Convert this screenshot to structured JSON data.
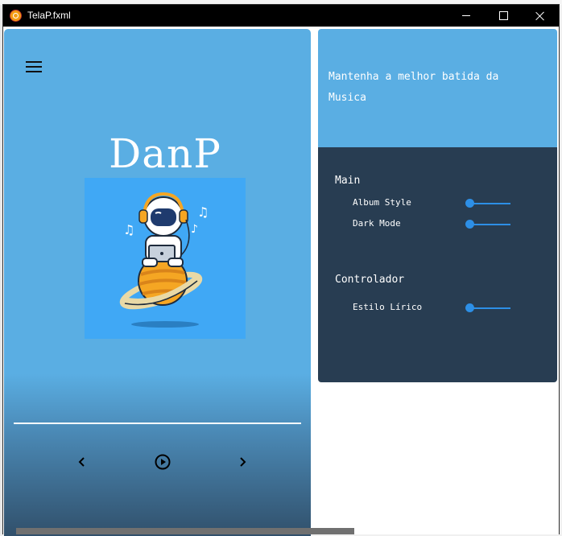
{
  "window": {
    "title": "TelaP.fxml"
  },
  "player": {
    "brand": "DanP",
    "album_art_icon": "astronaut-headphones-laptop-planet",
    "controls": {
      "prev_icon": "chevron-left-icon",
      "play_icon": "play-circle-icon",
      "next_icon": "chevron-right-icon"
    }
  },
  "info": {
    "text": "Mantenha a melhor batida da Musica"
  },
  "settings": {
    "main_title": "Main",
    "main_items": [
      {
        "label": "Album Style",
        "enabled": false
      },
      {
        "label": "Dark Mode",
        "enabled": false
      }
    ],
    "controller_title": "Controlador",
    "controller_items": [
      {
        "label": "Estilo Lírico",
        "enabled": false
      }
    ]
  },
  "colors": {
    "panel_blue": "#5aaee3",
    "settings_bg": "#283d52",
    "toggle_accent": "#2d8fe6",
    "album_bg": "#40a8f5"
  }
}
